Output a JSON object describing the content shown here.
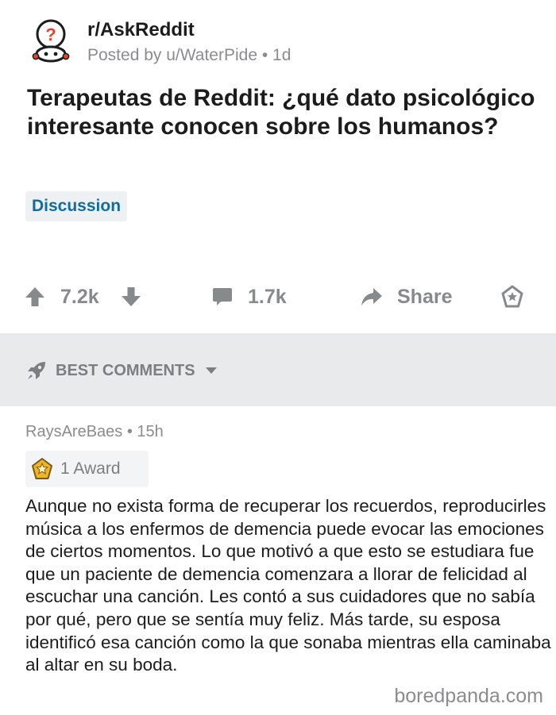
{
  "post": {
    "subreddit": "r/AskReddit",
    "posted_by": "Posted by u/WaterPide • 1d",
    "title": "Terapeutas de Reddit: ¿qué dato psicológico interesante conocen sobre los humanos?",
    "flair": "Discussion"
  },
  "actions": {
    "upvotes": "7.2k",
    "comments": "1.7k",
    "share_label": "Share",
    "icons": [
      "upvote-arrow",
      "downvote-arrow",
      "comment-bubble",
      "share-arrow",
      "award-badge"
    ]
  },
  "sort": {
    "label": "BEST COMMENTS",
    "icon": "rocket",
    "dropdown": "caret-down"
  },
  "comment": {
    "author_line": "RaysAreBaes • 15h",
    "award_label": "1 Award",
    "body": "Aunque no exista forma de recuperar los recuerdos, reproducirles música a los enfermos de demencia puede evocar las emociones de ciertos momentos. Lo que motivó a que esto se estudiara fue que un paciente de demencia comenzara a llorar de felicidad al escuchar una canción. Les contó a sus cuidadores que no sabía por qué, pero que se sentía muy feliz. Más tarde, su esposa identificó esa canción como la que sonaba mientras ella caminaba al altar en su boda."
  },
  "watermark": "boredpanda.com",
  "colors": {
    "text": "#1c1c1c",
    "muted": "#878a8c",
    "flair_text": "#0f6da0",
    "flair_bg": "#eef1f4",
    "sort_bar_bg": "#e8eaec",
    "award_gold": "#f0b429"
  }
}
